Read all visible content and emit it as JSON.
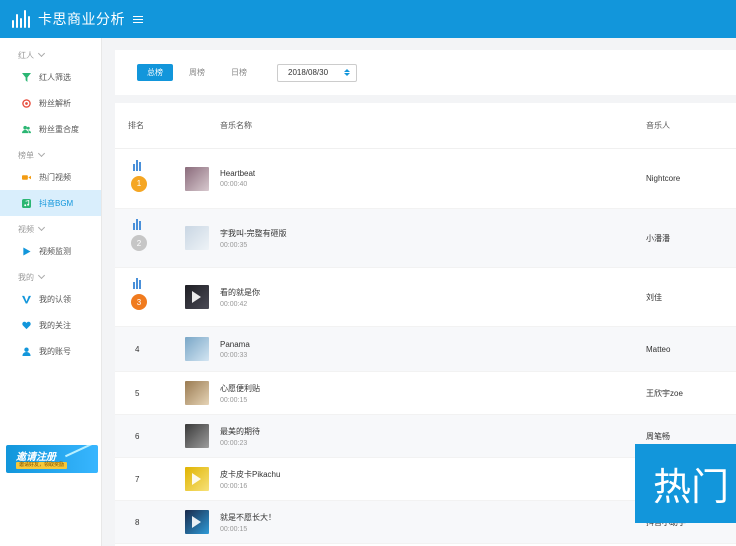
{
  "app": {
    "title": "卡思商业分析"
  },
  "sidebar": {
    "groups": [
      {
        "title": "红人",
        "items": [
          {
            "label": "红人筛选",
            "icon": "filter-icon",
            "color": "#2bb673"
          },
          {
            "label": "粉丝解析",
            "icon": "target-icon",
            "color": "#e74c3c"
          },
          {
            "label": "粉丝重合度",
            "icon": "users-icon",
            "color": "#2bb673"
          }
        ]
      },
      {
        "title": "榜单",
        "items": [
          {
            "label": "热门视频",
            "icon": "video-camera-icon",
            "color": "#f39c12"
          },
          {
            "label": "抖音BGM",
            "icon": "music-note-icon",
            "color": "#2bb673",
            "active": true
          }
        ]
      },
      {
        "title": "视频",
        "items": [
          {
            "label": "视频监测",
            "icon": "play-icon",
            "color": "#1296db"
          }
        ]
      },
      {
        "title": "我的",
        "items": [
          {
            "label": "我的认领",
            "icon": "verified-v-icon",
            "color": "#1296db"
          },
          {
            "label": "我的关注",
            "icon": "heart-icon",
            "color": "#1296db"
          },
          {
            "label": "我的账号",
            "icon": "user-icon",
            "color": "#1296db"
          }
        ]
      }
    ],
    "invite": {
      "title": "邀请注册",
      "subtitle": "邀请好友，领取奖励"
    }
  },
  "filters": {
    "tabs": [
      {
        "label": "总榜",
        "active": true
      },
      {
        "label": "周榜",
        "active": false
      },
      {
        "label": "日榜",
        "active": false
      }
    ],
    "date": "2018/08/30"
  },
  "table": {
    "headers": {
      "rank": "排名",
      "title": "音乐名称",
      "artist": "音乐人"
    },
    "rows": [
      {
        "rank": "1",
        "name": "Heartbeat",
        "duration": "00:00:40",
        "artist": "Nightcore",
        "cover": [
          "#8a6b7b",
          "#d8c9cf"
        ]
      },
      {
        "rank": "2",
        "name": "字我叫-完整有砸版",
        "duration": "00:00:35",
        "artist": "小潘潘",
        "cover": [
          "#c9d6e3",
          "#eef3f7"
        ]
      },
      {
        "rank": "3",
        "name": "看的就是你",
        "duration": "00:00:42",
        "artist": "刘佳",
        "cover": [
          "#1e1e24",
          "#4a4a55"
        ],
        "play": true
      },
      {
        "rank": "4",
        "name": "Panama",
        "duration": "00:00:33",
        "artist": "Matteo",
        "cover": [
          "#7aa7c7",
          "#d3e5f2"
        ]
      },
      {
        "rank": "5",
        "name": "心愿便利贴",
        "duration": "00:00:15",
        "artist": "王欣宇zoe",
        "cover": [
          "#9a7b52",
          "#e6d4b6"
        ]
      },
      {
        "rank": "6",
        "name": "最美的期待",
        "duration": "00:00:23",
        "artist": "周笔畅",
        "cover": [
          "#3a3a3a",
          "#9d9d9d"
        ]
      },
      {
        "rank": "7",
        "name": "皮卡皮卡Pikachu",
        "duration": "00:00:16",
        "artist": "",
        "cover": [
          "#e0b300",
          "#f7e27a"
        ],
        "play": true
      },
      {
        "rank": "8",
        "name": "就是不愿长大！",
        "duration": "00:00:15",
        "artist": "抖音小助手",
        "cover": [
          "#1a2a4a",
          "#2f9bd8"
        ],
        "play": true
      }
    ]
  },
  "overlay": {
    "text": "热门"
  },
  "colors": {
    "primary": "#1296db",
    "gold": "#f5a623",
    "silver": "#c6c6c6",
    "bronze": "#f07b1f"
  }
}
